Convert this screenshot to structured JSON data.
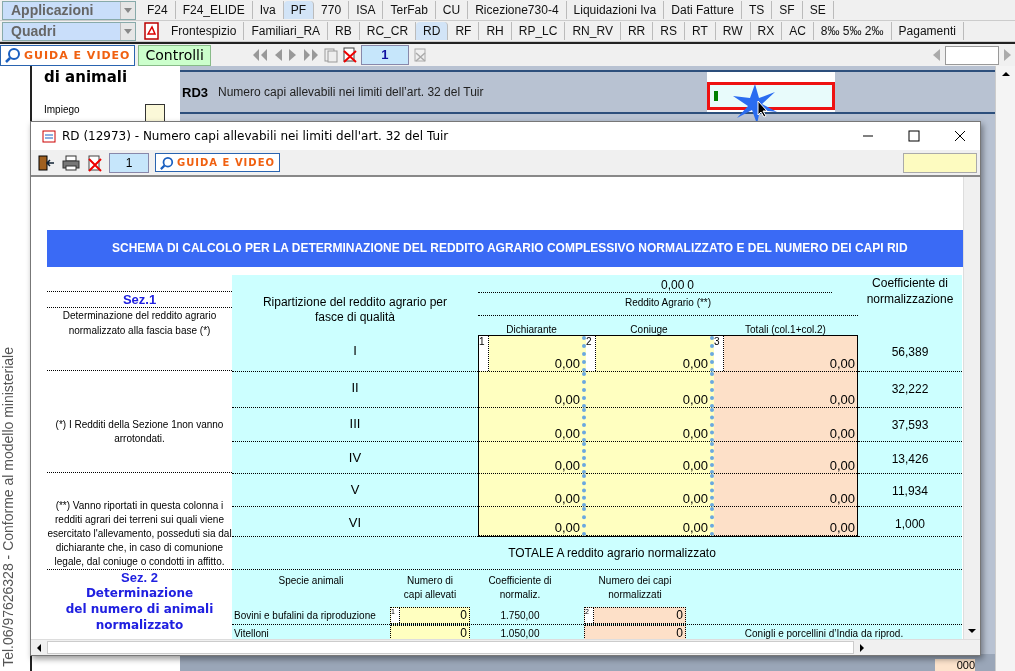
{
  "app": {
    "applications_label": "Applicazioni",
    "sheets_label": "Quadri",
    "app_tabs": [
      {
        "label": "F24",
        "selected": false
      },
      {
        "label": "F24_ELIDE",
        "selected": false
      },
      {
        "label": "Iva",
        "selected": false
      },
      {
        "label": "PF",
        "selected": true
      },
      {
        "label": "770",
        "selected": false
      },
      {
        "label": "ISA",
        "selected": false
      },
      {
        "label": "TerFab",
        "selected": false
      },
      {
        "label": "CU",
        "selected": false
      },
      {
        "label": "Ricezione730-4",
        "selected": false
      },
      {
        "label": "Liquidazioni Iva",
        "selected": false
      },
      {
        "label": "Dati Fatture",
        "selected": false
      },
      {
        "label": "TS",
        "selected": false
      },
      {
        "label": "SF",
        "selected": false
      },
      {
        "label": "SE",
        "selected": false
      }
    ],
    "sheet_tabs": [
      {
        "label": "Frontespizio",
        "selected": false
      },
      {
        "label": "Familiari_RA",
        "selected": false
      },
      {
        "label": "RB",
        "selected": false
      },
      {
        "label": "RC_CR",
        "selected": false
      },
      {
        "label": "RD",
        "selected": true
      },
      {
        "label": "RF",
        "selected": false
      },
      {
        "label": "RH",
        "selected": false
      },
      {
        "label": "RP_LC",
        "selected": false
      },
      {
        "label": "RN_RV",
        "selected": false
      },
      {
        "label": "RR",
        "selected": false
      },
      {
        "label": "RS",
        "selected": false
      },
      {
        "label": "RT",
        "selected": false
      },
      {
        "label": "RW",
        "selected": false
      },
      {
        "label": "RX",
        "selected": false
      },
      {
        "label": "AC",
        "selected": false
      },
      {
        "label": "8‰ 5‰ 2‰",
        "selected": false
      },
      {
        "label": "Pagamenti",
        "selected": false
      }
    ],
    "help_button": "GUIDA E VIDEO",
    "check_button": "Controlli",
    "page_field": "1",
    "side_panel": {
      "vertical_text": "Tel.06/97626328 - Conforme al modello ministeriale",
      "section_title": "di animali",
      "item_label": "Impiego",
      "item_checked": false
    },
    "main": {
      "row_code": "RD3",
      "row_label": "Numero capi allevabili nei limiti dell’art. 32 del Tuir",
      "field_highlighted": true,
      "bottom_value": "000"
    }
  },
  "dialog": {
    "title": "RD (12973) - Numero capi allevabili nei limiti dell'art. 32 del Tuir",
    "page_field": "1",
    "help_button": "GUIDA E VIDEO",
    "banner": "SCHEMA DI CALCOLO PER LA DETERMINAZIONE DEL REDDITO AGRARIO COMPLESSIVO NORMALIZZATO E DEL NUMERO DEI CAPI RID",
    "sez1": {
      "title": "Sez.1",
      "description": "Determinazione del reddito agrario normalizzato alla fascia base (*)",
      "note_1": "(*) I Redditi della Sezione 1non vanno arrotondati.",
      "note_2": "(**) Vanno riportati in questa colonna i redditi agrari dei terreni sui quali viene esercitato l'allevamento, posseduti sia dal dichiarante che, in caso di comunione legale, dal coniuge o condotti in affitto.",
      "band_heading": "Ripartizione del reddito agrario per fasce di qualità",
      "sum_value": "0,00",
      "sum_count": "0",
      "income_heading": "Reddito Agrario (**)",
      "columns": [
        "Dichiarante",
        "Coniuge",
        "Totali (col.1+col.2)"
      ],
      "column_numbers": [
        "1",
        "2",
        "3"
      ],
      "coefficient_heading": "Coefficiente di normalizzazione",
      "rows": [
        {
          "band": "I",
          "values": [
            "0,00",
            "0,00",
            "0,00"
          ],
          "coefficient": "56,389"
        },
        {
          "band": "II",
          "values": [
            "0,00",
            "0,00",
            "0,00"
          ],
          "coefficient": "32,222"
        },
        {
          "band": "III",
          "values": [
            "0,00",
            "0,00",
            "0,00"
          ],
          "coefficient": "37,593"
        },
        {
          "band": "IV",
          "values": [
            "0,00",
            "0,00",
            "0,00"
          ],
          "coefficient": "13,426"
        },
        {
          "band": "V",
          "values": [
            "0,00",
            "0,00",
            "0,00"
          ],
          "coefficient": "11,934"
        },
        {
          "band": "VI",
          "values": [
            "0,00",
            "0,00",
            "0,00"
          ],
          "coefficient": "1,000"
        }
      ],
      "total_label": "TOTALE A reddito agrario normalizzato"
    },
    "sez2": {
      "title": "Sez. 2",
      "subtitle_lines": [
        "Determinazione",
        "del numero di animali",
        "normalizzato"
      ],
      "columns": [
        "Specie animali",
        "Numero di capi allevati",
        "Coefficiente di normaliz.",
        "Numero dei capi normalizzati"
      ],
      "rows": [
        {
          "species": "Bovini e bufalini da riproduzione",
          "count_number": "1",
          "count": "0",
          "coefficient": "1.750,00",
          "normalized_number": "2",
          "normalized": "0"
        },
        {
          "species": "Vitelloni",
          "count": "0",
          "coefficient": "1.050,00",
          "normalized": "0"
        }
      ],
      "side_note": "Conigli e porcellini d’India da riprod."
    }
  }
}
